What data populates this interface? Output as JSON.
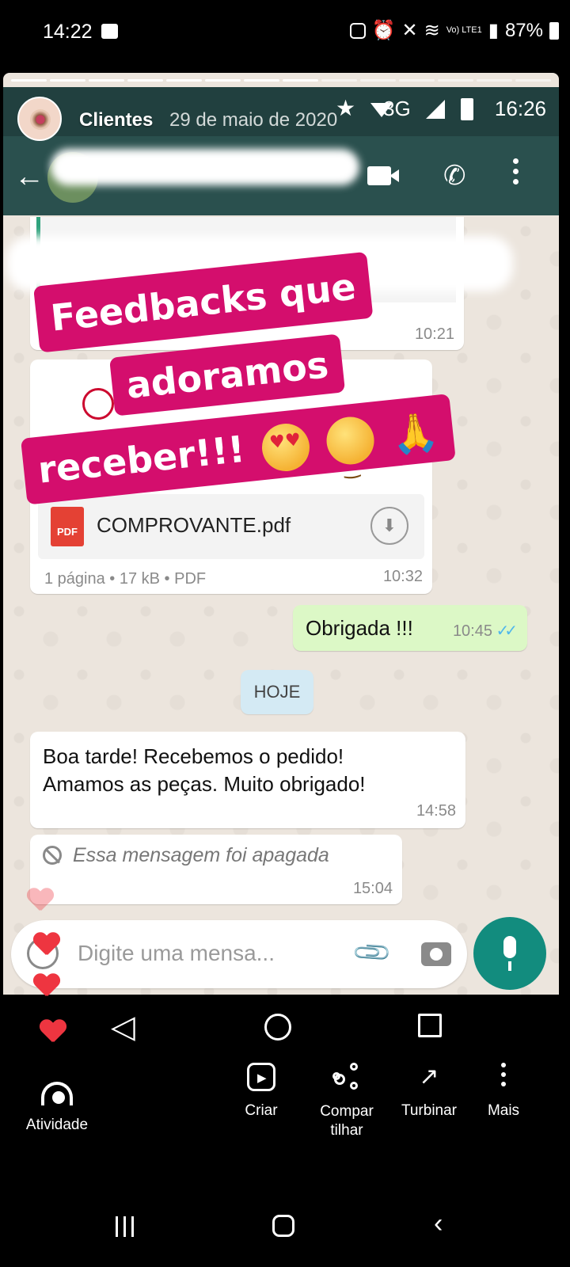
{
  "device_status": {
    "time": "14:22",
    "battery": "87%",
    "carrier": "Vo) LTE1"
  },
  "story": {
    "progress": {
      "segments": 14,
      "completed": 8
    },
    "account_name": "Clientes",
    "date": "29 de maio de 2020",
    "sticker": {
      "line1": "Feedbacks que",
      "line2": "adoramos",
      "line3": "receber!!!",
      "emojis": [
        "smiling-face-with-hearts",
        "heart-eyes",
        "folded-hands"
      ]
    }
  },
  "screenshot_status": {
    "network": "3G",
    "time": "16:26"
  },
  "chat": {
    "msg1": {
      "time": "10:21"
    },
    "file_msg": {
      "file_name": "COMPROVANTE.pdf",
      "file_type_badge": "PDF",
      "meta": "1 página • 17 kB • PDF",
      "time": "10:32"
    },
    "out_msg": {
      "text": "Obrigada !!!",
      "time": "10:45",
      "status": "read"
    },
    "date_divider": "HOJE",
    "msg2": {
      "text": "Boa tarde! Recebemos o pedido!\nAmamos as peças. Muito obrigado!",
      "time": "14:58"
    },
    "deleted_msg": {
      "text": "Essa mensagem foi apagada",
      "time": "15:04"
    },
    "input_placeholder": "Digite uma mensa..."
  },
  "actions": {
    "atividade": "Atividade",
    "criar": "Criar",
    "compartilhar_line1": "Compar",
    "compartilhar_line2": "tilhar",
    "turbinar": "Turbinar",
    "mais": "Mais"
  },
  "colors": {
    "sticker_bg": "#d40e6d",
    "whatsapp_toolbar": "#2a504e",
    "mic_button": "#128c7e",
    "outgoing_bubble": "#dcf8c6",
    "heart": "#ee3540"
  }
}
